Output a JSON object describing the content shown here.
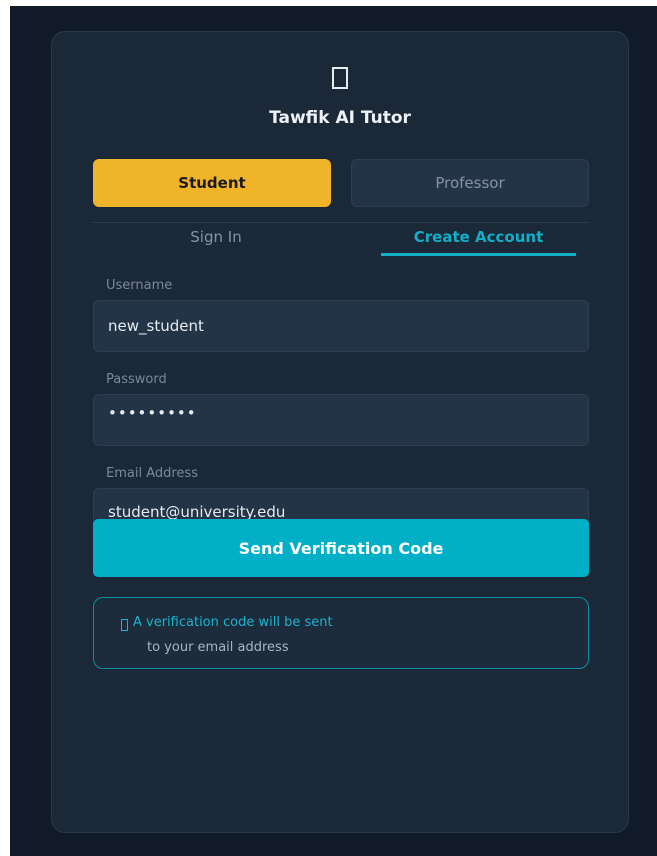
{
  "app": {
    "title": "Tawfik AI Tutor",
    "logo_icon": "book-icon"
  },
  "roles": {
    "student_label": "Student",
    "professor_label": "Professor",
    "selected": "Student"
  },
  "tabs": {
    "sign_in_label": "Sign In",
    "create_account_label": "Create Account",
    "active": "Create Account"
  },
  "form": {
    "username_label": "Username",
    "username_value": "new_student",
    "password_label": "Password",
    "password_value": "•••••••••",
    "email_label": "Email Address",
    "email_value": "student@university.edu"
  },
  "send_button_label": "Send Verification Code",
  "info": {
    "icon": "email-icon",
    "line1": "A verification code will be sent",
    "line2": "to your email address"
  },
  "colors": {
    "background": "#111b27",
    "card": "#1b2837",
    "accent_yellow": "#f0b42a",
    "accent_cyan": "#01afc6"
  }
}
